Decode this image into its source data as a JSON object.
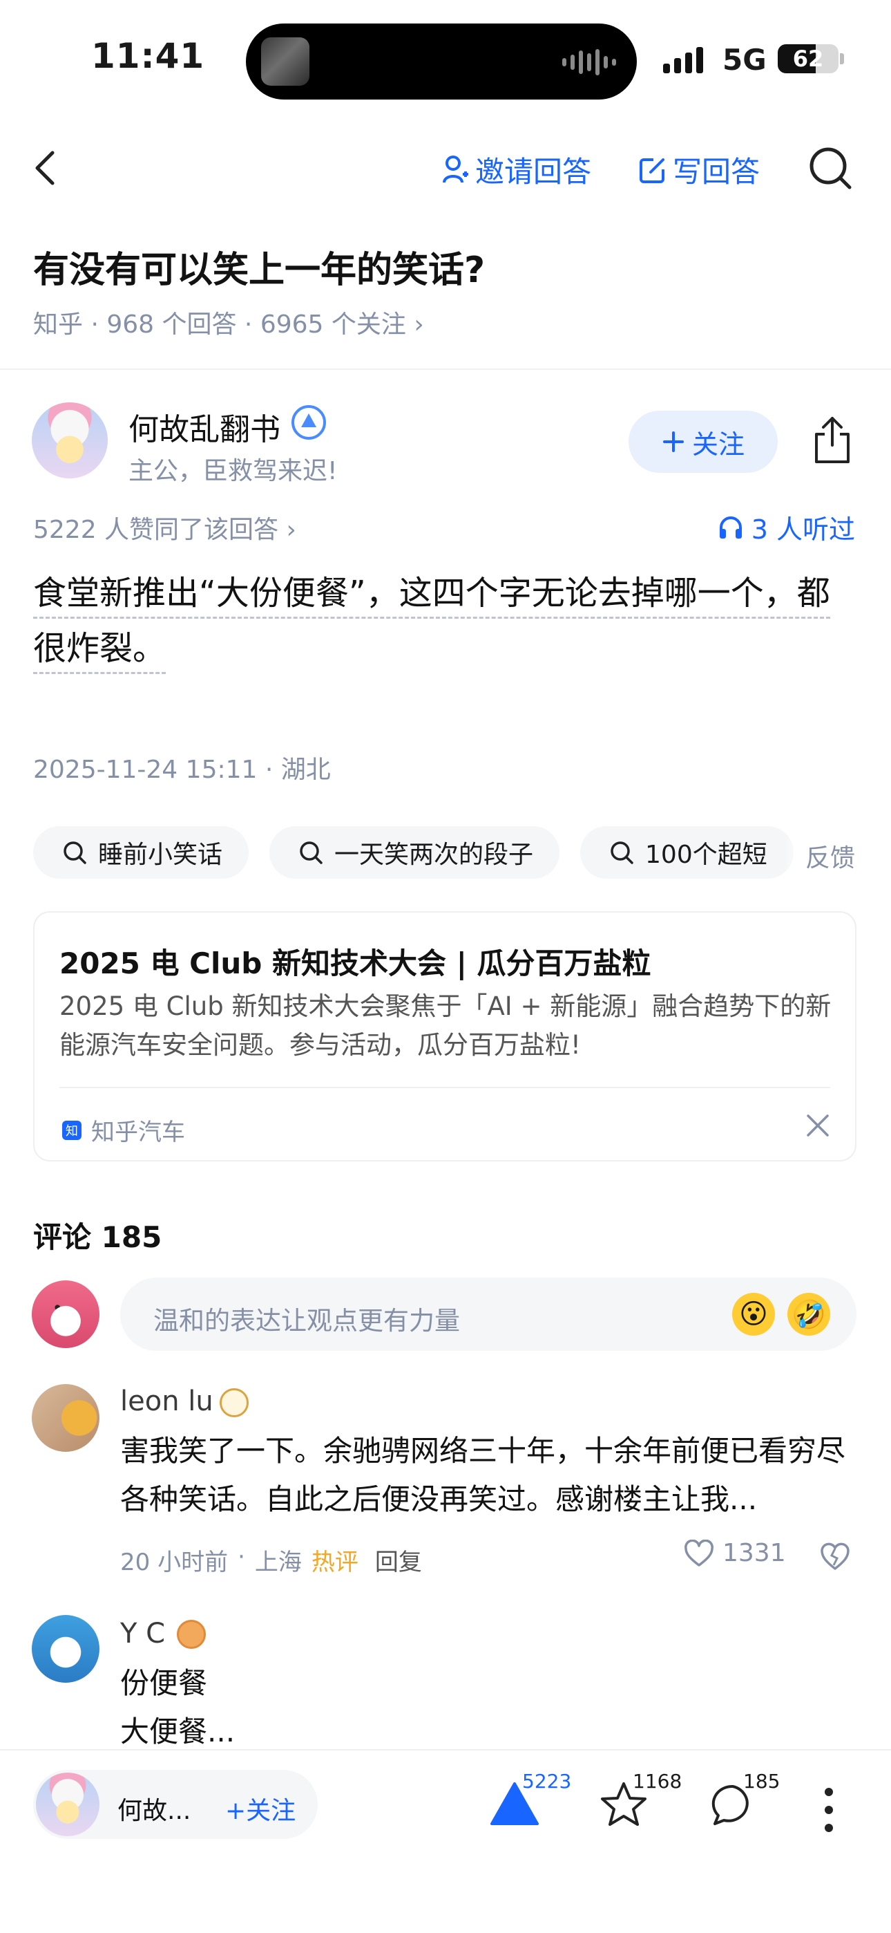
{
  "status_bar": {
    "time": "11:41",
    "network": "5G",
    "battery": "62",
    "battery_level": 0.62
  },
  "nav": {
    "invite_label": "邀请回答",
    "write_label": "写回答"
  },
  "question": {
    "title": "有没有可以笑上一年的笑话?",
    "meta": "知乎 · 968 个回答 · 6965 个关注 ›"
  },
  "author": {
    "name": "何故乱翻书",
    "bio": "主公，臣救驾来迟!",
    "follow_label": "关注"
  },
  "answer": {
    "likes_line": "5222 人赞同了该回答 ›",
    "listeners": "3 人听过",
    "content": "食堂新推出“大份便餐”，这四个字无论去掉哪一个，都很炸裂。",
    "time_location": "2025-11-24 15:11 · 湖北"
  },
  "search_chips": [
    "睡前小笑话",
    "一天笑两次的段子",
    "100个超短"
  ],
  "feedback_label": "反馈",
  "ad": {
    "title": "2025 电 Club 新知技术大会 | 瓜分百万盐粒",
    "desc": "2025 电 Club 新知技术大会聚焦于「AI + 新能源」融合趋势下的新能源汽车安全问题。参与活动，瓜分百万盐粒!",
    "logo_char": "知",
    "source": "知乎汽车"
  },
  "comments": {
    "title": "评论 185",
    "placeholder": "温和的表达让观点更有力量",
    "emojis": [
      "😮",
      "🤣"
    ],
    "items": [
      {
        "name": "leon lu",
        "text": "害我笑了一下。余驰骋网络三十年，十余年前便已看穷尽各种笑话。自此之后便没再笑过。感谢楼主让我...",
        "time": "20 小时前",
        "location": "上海",
        "tag": "热评",
        "reply": "回复",
        "likes": "1331"
      },
      {
        "name": "Y C",
        "text_line1": "份便餐",
        "text_line2": "大便餐..."
      }
    ]
  },
  "bottom_bar": {
    "author_short": "何故...",
    "follow_label": "+关注",
    "votes": "5223",
    "favorites": "1168",
    "comments": "185"
  },
  "colors": {
    "accent": "#1965ff",
    "muted": "#8590a6",
    "hot": "#f5a623"
  }
}
